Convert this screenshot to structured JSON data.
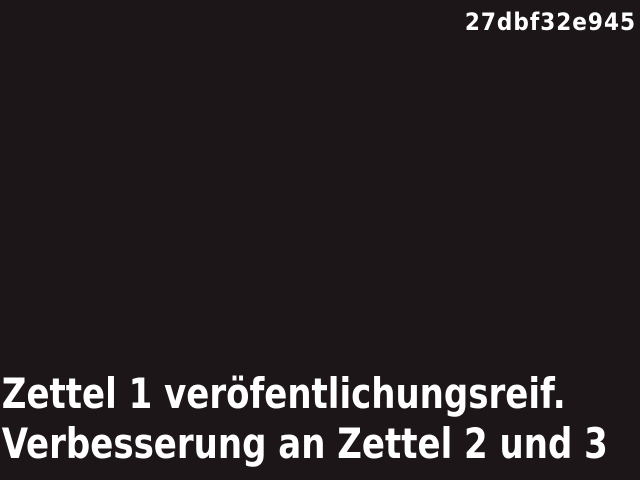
{
  "hash_label": "27dbf32e945",
  "caption": {
    "line1": "Zettel 1 veröfentlichungsreif.",
    "line2": "Verbesserung an Zettel 2 und 3"
  }
}
